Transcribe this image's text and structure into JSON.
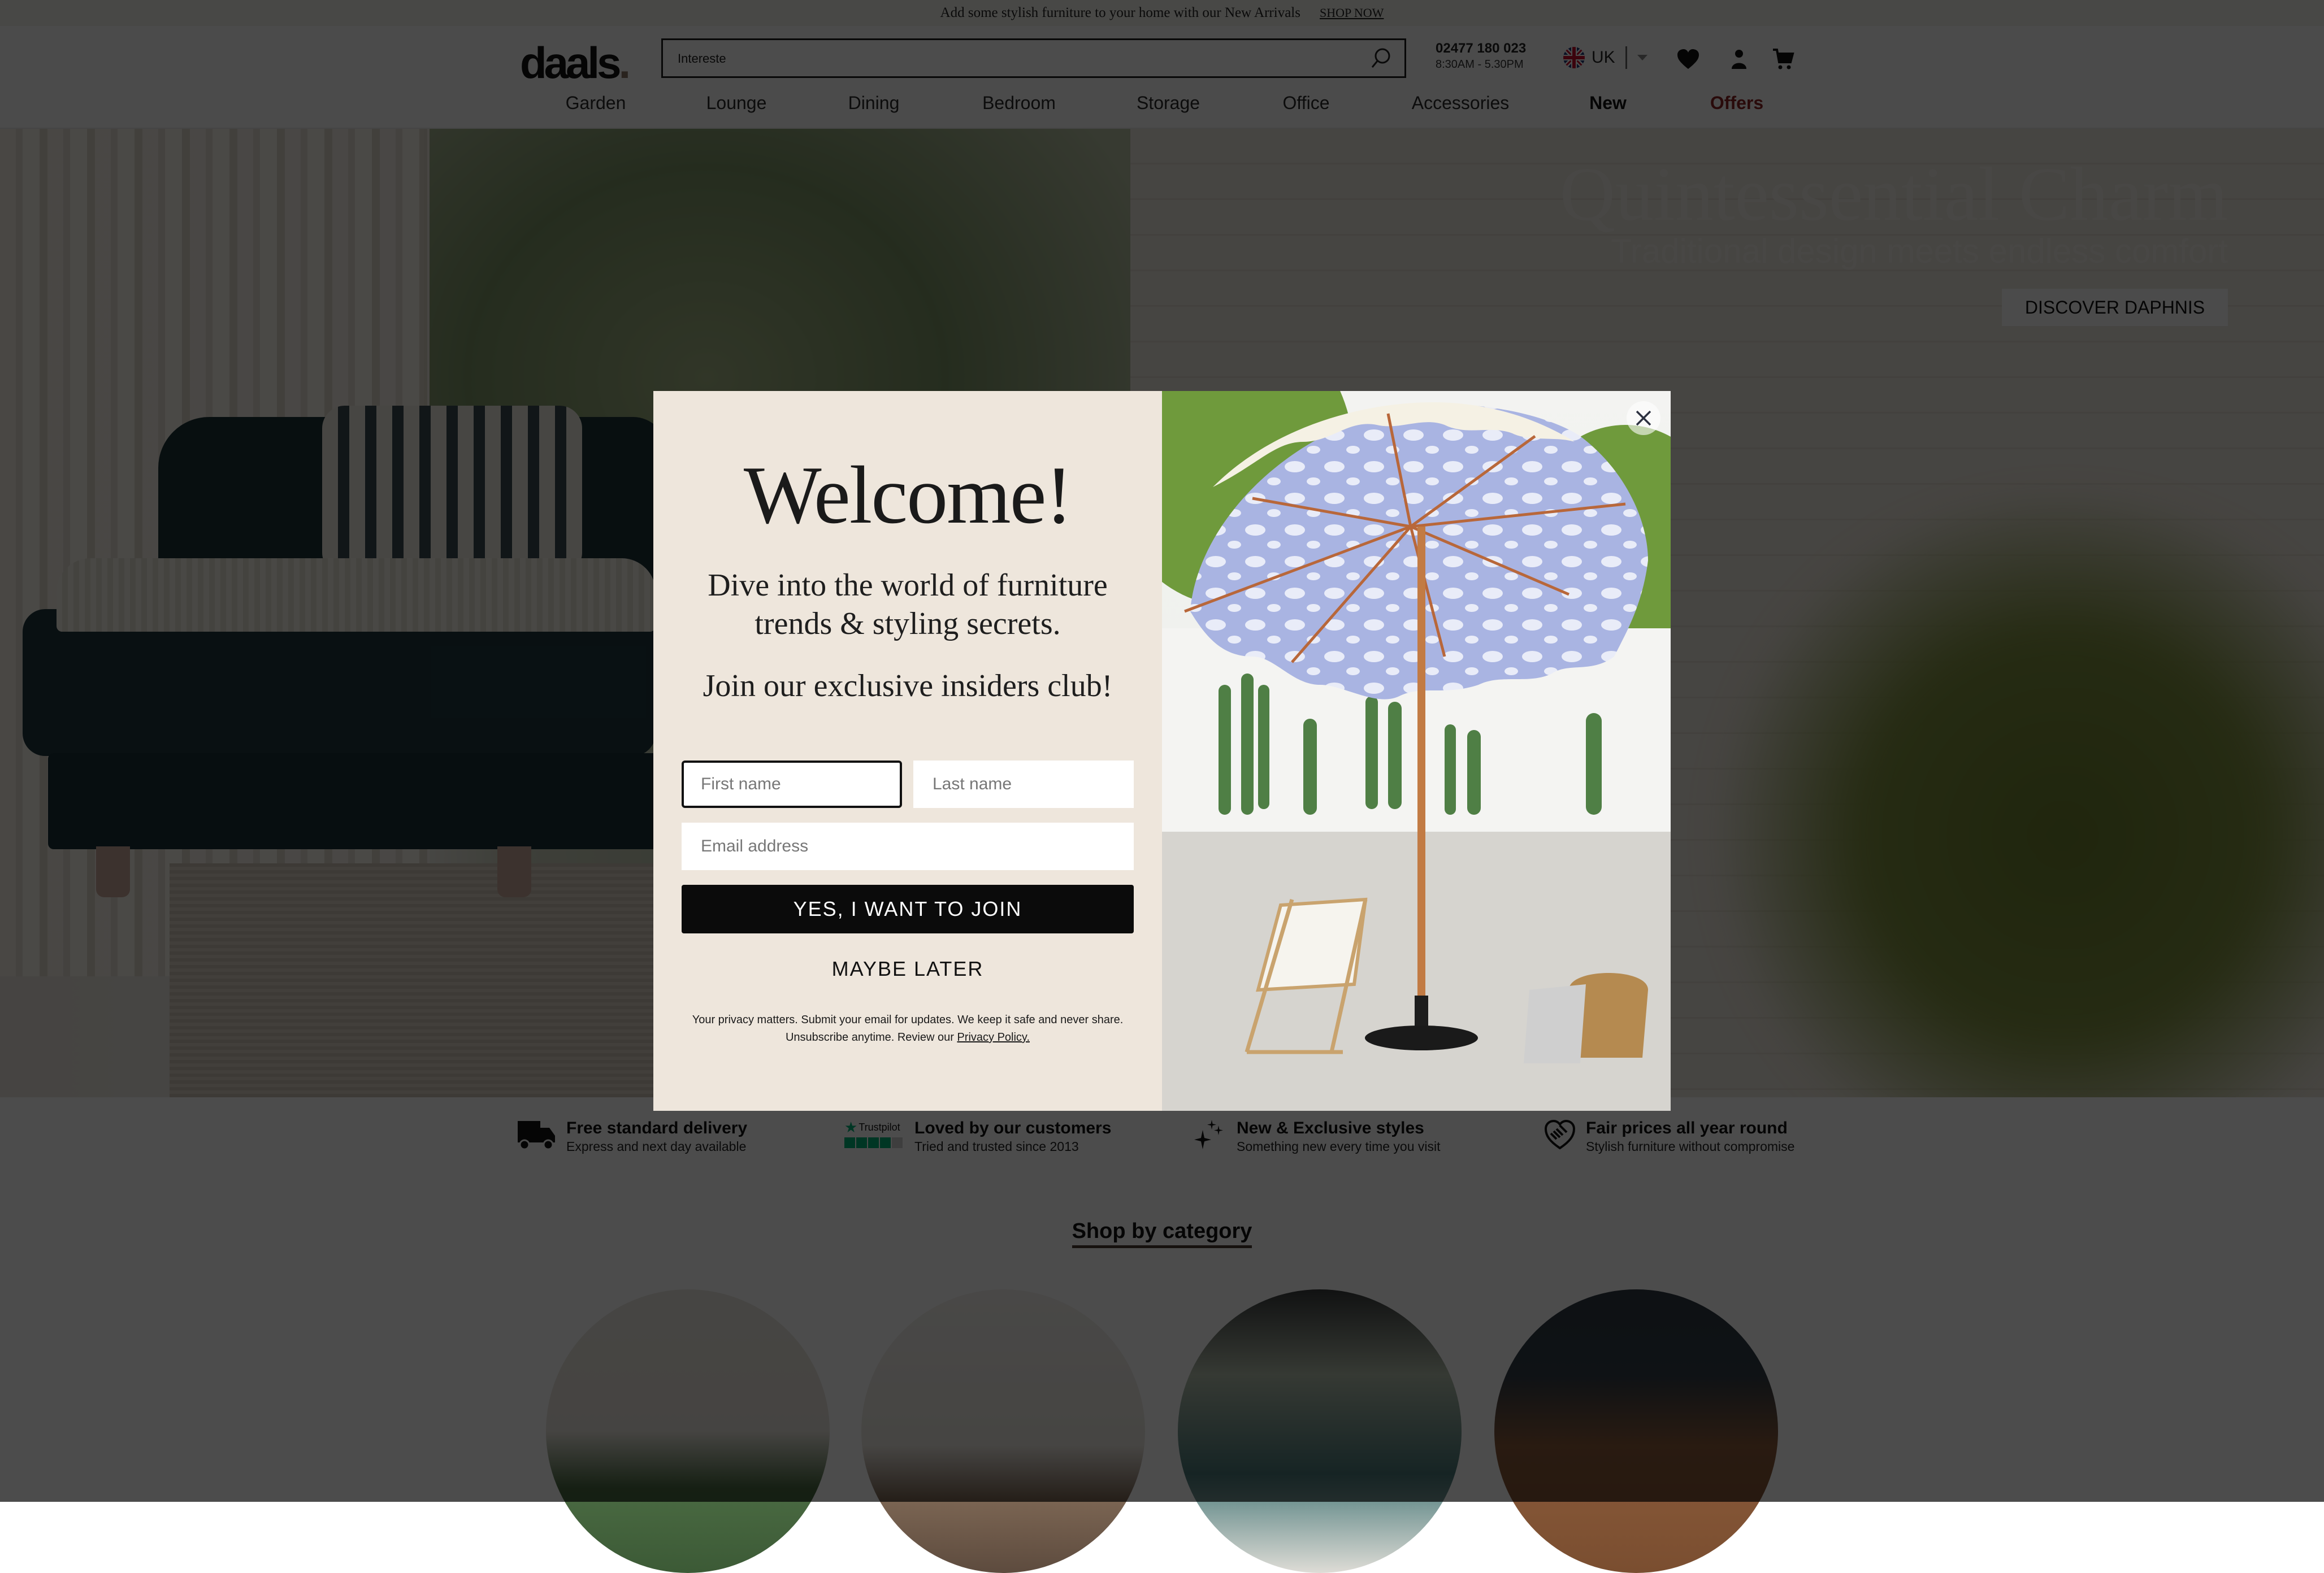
{
  "announcement": {
    "text": "Add some stylish furniture to your home with our New Arrivals",
    "link": "SHOP NOW"
  },
  "header": {
    "logo": "daals",
    "search": {
      "value": "Intereste",
      "placeholder": ""
    },
    "phone": {
      "number": "02477 180 023",
      "hours": "8:30AM - 5.30PM"
    },
    "locale": "UK",
    "icons": [
      "heart-icon",
      "user-icon",
      "cart-icon"
    ]
  },
  "nav": {
    "items": [
      {
        "label": "Garden"
      },
      {
        "label": "Lounge"
      },
      {
        "label": "Dining"
      },
      {
        "label": "Bedroom"
      },
      {
        "label": "Storage"
      },
      {
        "label": "Office"
      },
      {
        "label": "Accessories"
      },
      {
        "label": "New"
      },
      {
        "label": "Offers"
      }
    ]
  },
  "hero": {
    "title": "Quintessential Charm",
    "subtitle": "Traditional design meets endless comfort",
    "cta": "DISCOVER DAPHNIS"
  },
  "features": [
    {
      "icon": "truck-icon",
      "title": "Free standard delivery",
      "subtitle": "Express and next day available"
    },
    {
      "icon": "trustpilot-icon",
      "badge": "Trustpilot",
      "title": "Loved by our customers",
      "subtitle": "Tried and trusted since 2013"
    },
    {
      "icon": "sparkle-icon",
      "title": "New & Exclusive styles",
      "subtitle": "Something new every time you visit"
    },
    {
      "icon": "handshake-icon",
      "title": "Fair prices all year round",
      "subtitle": "Stylish furniture without compromise"
    }
  ],
  "shop_by_category": {
    "title": "Shop by category"
  },
  "modal": {
    "heading": "Welcome!",
    "lead_line1": "Dive into the world of furniture",
    "lead_line2": "trends & styling secrets.",
    "join_text": "Join our exclusive insiders club!",
    "first_name_placeholder": "First name",
    "last_name_placeholder": "Last name",
    "email_placeholder": "Email address",
    "join_button": "YES, I WANT TO JOIN",
    "later_button": "MAYBE LATER",
    "privacy_text": "Your privacy matters. Submit your email for updates. We keep it safe and never share. Unsubscribe anytime. Review our ",
    "privacy_link": "Privacy Policy."
  },
  "colors": {
    "offers": "#8b2222",
    "modal_bg": "#eee6dc",
    "join_button": "#0b0b0b",
    "trustpilot_green": "#00b67a"
  }
}
